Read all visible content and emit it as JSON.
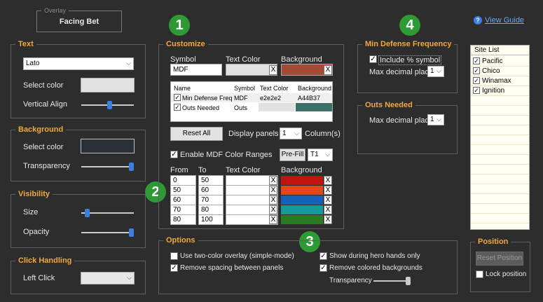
{
  "overlay": {
    "legend": "Overlay",
    "title": "Facing Bet"
  },
  "badges": [
    "1",
    "2",
    "3",
    "4"
  ],
  "view_guide": "View Guide",
  "text_group": {
    "legend": "Text",
    "font": "Lato",
    "select_color_label": "Select color",
    "vertical_align_label": "Vertical Align",
    "vertical_align_level": 0.5
  },
  "background_group": {
    "legend": "Background",
    "select_color_label": "Select color",
    "transparency_label": "Transparency",
    "transparency_level": 1.0,
    "color": "#2a2f38"
  },
  "visibility_group": {
    "legend": "Visibility",
    "size_label": "Size",
    "size_level": 0.1,
    "opacity_label": "Opacity",
    "opacity_level": 1.0
  },
  "click_group": {
    "legend": "Click Handling",
    "left_click_label": "Left Click",
    "left_click_value": ""
  },
  "customize": {
    "legend": "Customize",
    "symbol_label": "Symbol",
    "text_color_label": "Text Color",
    "background_label": "Background",
    "symbol_value": "MDF",
    "bg_color": "#a44b37",
    "panel_table": {
      "headers": [
        "Name",
        "Symbol",
        "Text Color",
        "Background"
      ],
      "rows": [
        {
          "checked": true,
          "name": "Min Defense Freq",
          "symbol": "MDF",
          "text_color": "e2e2e2",
          "background": "A44B37",
          "bg_swatch": ""
        },
        {
          "checked": true,
          "name": "Outs Needed",
          "symbol": "Outs",
          "text_color": "",
          "background": "",
          "bg_swatch": "#3d6f69"
        }
      ]
    },
    "reset_all": "Reset All",
    "display_panels_on": "Display panels on",
    "columns_value": "1",
    "columns_label": "Column(s)",
    "enable_ranges_label": "Enable MDF Color Ranges",
    "enable_ranges_checked": true,
    "prefill": "Pre-Fill",
    "preset": "T1",
    "ranges_headers": [
      "From",
      "To",
      "Text Color",
      "Background"
    ],
    "ranges": [
      {
        "from": "0",
        "to": "50",
        "color": "#c0140f"
      },
      {
        "from": "50",
        "to": "60",
        "color": "#e0481a"
      },
      {
        "from": "60",
        "to": "70",
        "color": "#1560b8"
      },
      {
        "from": "70",
        "to": "80",
        "color": "#159a9a"
      },
      {
        "from": "80",
        "to": "100",
        "color": "#2a7a23"
      }
    ],
    "clear": "X"
  },
  "mdf": {
    "legend": "Min Defense Frequency",
    "include_label": "Include % symbol",
    "include_checked": true,
    "max_decimal_label": "Max decimal places",
    "max_decimal_value": "1"
  },
  "outs": {
    "legend": "Outs Needed",
    "max_decimal_label": "Max decimal places",
    "max_decimal_value": "1"
  },
  "sites": {
    "header": "Site List",
    "items": [
      {
        "name": "Pacific",
        "checked": true
      },
      {
        "name": "Chico",
        "checked": true
      },
      {
        "name": "Winamax",
        "checked": true
      },
      {
        "name": "Ignition",
        "checked": true
      }
    ]
  },
  "options": {
    "legend": "Options",
    "two_color": {
      "label": "Use two-color overlay (simple-mode)",
      "checked": false
    },
    "remove_spacing": {
      "label": "Remove spacing between panels",
      "checked": true
    },
    "hero_hands": {
      "label": "Show during hero hands only",
      "checked": true
    },
    "remove_colored": {
      "label": "Remove colored backgrounds",
      "checked": true
    },
    "transparency_label": "Transparency",
    "transparency_level": 1.0
  },
  "position": {
    "legend": "Position",
    "reset": "Reset Position",
    "lock_label": "Lock position",
    "lock_checked": false
  },
  "colors": {
    "accent": "#f0a93a",
    "badge": "#2e9a34",
    "link": "#6aa7ff",
    "slider_thumb": "#3b7fe0"
  },
  "icons": {
    "help": "help-circle-icon",
    "check": "check-icon",
    "chevron": "chevron-down-icon"
  }
}
